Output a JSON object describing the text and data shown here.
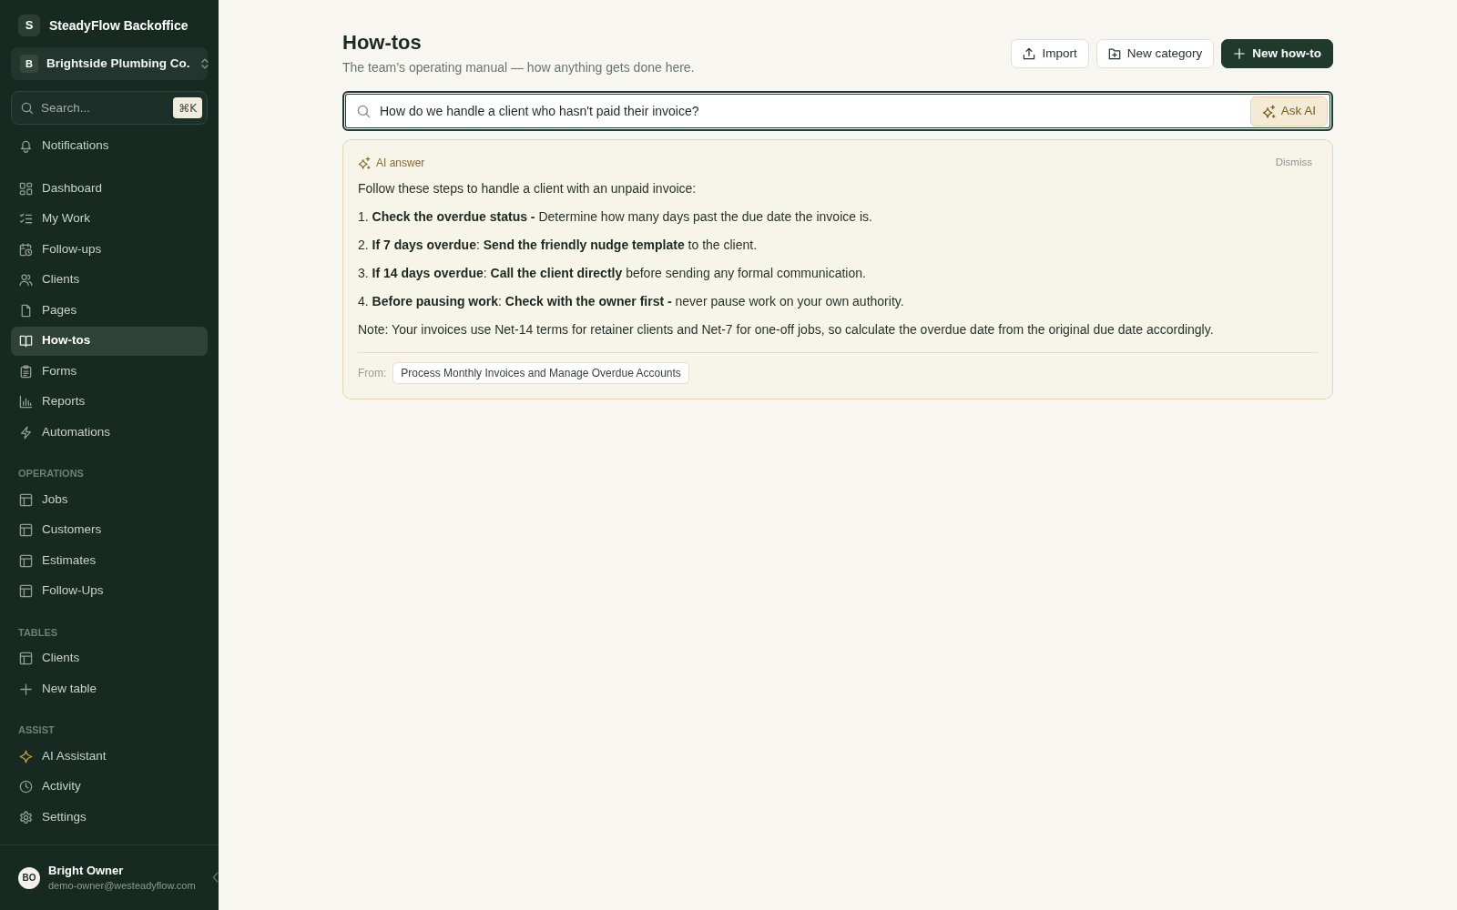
{
  "sidebar": {
    "app": {
      "logo": "S",
      "name": "SteadyFlow Backoffice"
    },
    "workspace": {
      "badge": "B",
      "name": "Brightside Plumbing Co."
    },
    "search": {
      "placeholder": "Search...",
      "shortcut": "⌘K"
    },
    "sections": [
      {
        "items": [
          {
            "label": "Notifications",
            "selected": false
          }
        ]
      },
      {
        "items": [
          {
            "label": "Dashboard",
            "selected": false
          },
          {
            "label": "My Work",
            "selected": false
          },
          {
            "label": "Follow-ups",
            "selected": false
          },
          {
            "label": "Clients",
            "selected": false
          },
          {
            "label": "Pages",
            "selected": false
          },
          {
            "label": "How-tos",
            "selected": true
          },
          {
            "label": "Forms",
            "selected": false
          },
          {
            "label": "Reports",
            "selected": false
          },
          {
            "label": "Automations",
            "selected": false
          }
        ]
      },
      {
        "heading": "OPERATIONS",
        "items": [
          {
            "label": "Jobs",
            "selected": false
          },
          {
            "label": "Customers",
            "selected": false
          },
          {
            "label": "Estimates",
            "selected": false
          },
          {
            "label": "Follow-Ups",
            "selected": false
          }
        ]
      },
      {
        "heading": "TABLES",
        "items": [
          {
            "label": "Clients",
            "selected": false
          },
          {
            "label": "New table",
            "selected": false
          }
        ]
      },
      {
        "heading": "ASSIST",
        "items": [
          {
            "label": "AI Assistant",
            "selected": false
          },
          {
            "label": "Activity",
            "selected": false
          },
          {
            "label": "Settings",
            "selected": false
          }
        ]
      }
    ],
    "user": {
      "initials": "BO",
      "name": "Bright Owner",
      "email": "demo-owner@westeadyflow.com"
    }
  },
  "header": {
    "title": "How-tos",
    "subtitle": "The team’s operating manual — how anything gets done here.",
    "actions": [
      {
        "label": "Import",
        "kind": "secondary"
      },
      {
        "label": "New category",
        "kind": "secondary"
      },
      {
        "label": "New how-to",
        "kind": "primary"
      }
    ]
  },
  "ask": {
    "value": "How do we handle a client who hasn't paid their invoice?",
    "button": "Ask AI"
  },
  "answer": {
    "label": "AI answer",
    "dismiss": "Dismiss",
    "intro": "Follow these steps to handle a client with an unpaid invoice:",
    "steps": [
      "1. **Check the overdue status -** Determine how many days past the due date the invoice is.",
      "2. **If 7 days overdue**: **Send the friendly nudge template** to the client.",
      "3. **If 14 days overdue**: **Call the client directly** before sending any formal communication.",
      "4. **Before pausing work**: **Check with the owner first -** never pause work on your own authority."
    ],
    "note": "Note: Your invoices use Net-14 terms for retainer clients and Net-7 for one-off jobs, so calculate the overdue date from the original due date accordingly.",
    "source_label": "From:",
    "source": "Process Monthly Invoices and Manage Overdue Accounts"
  }
}
